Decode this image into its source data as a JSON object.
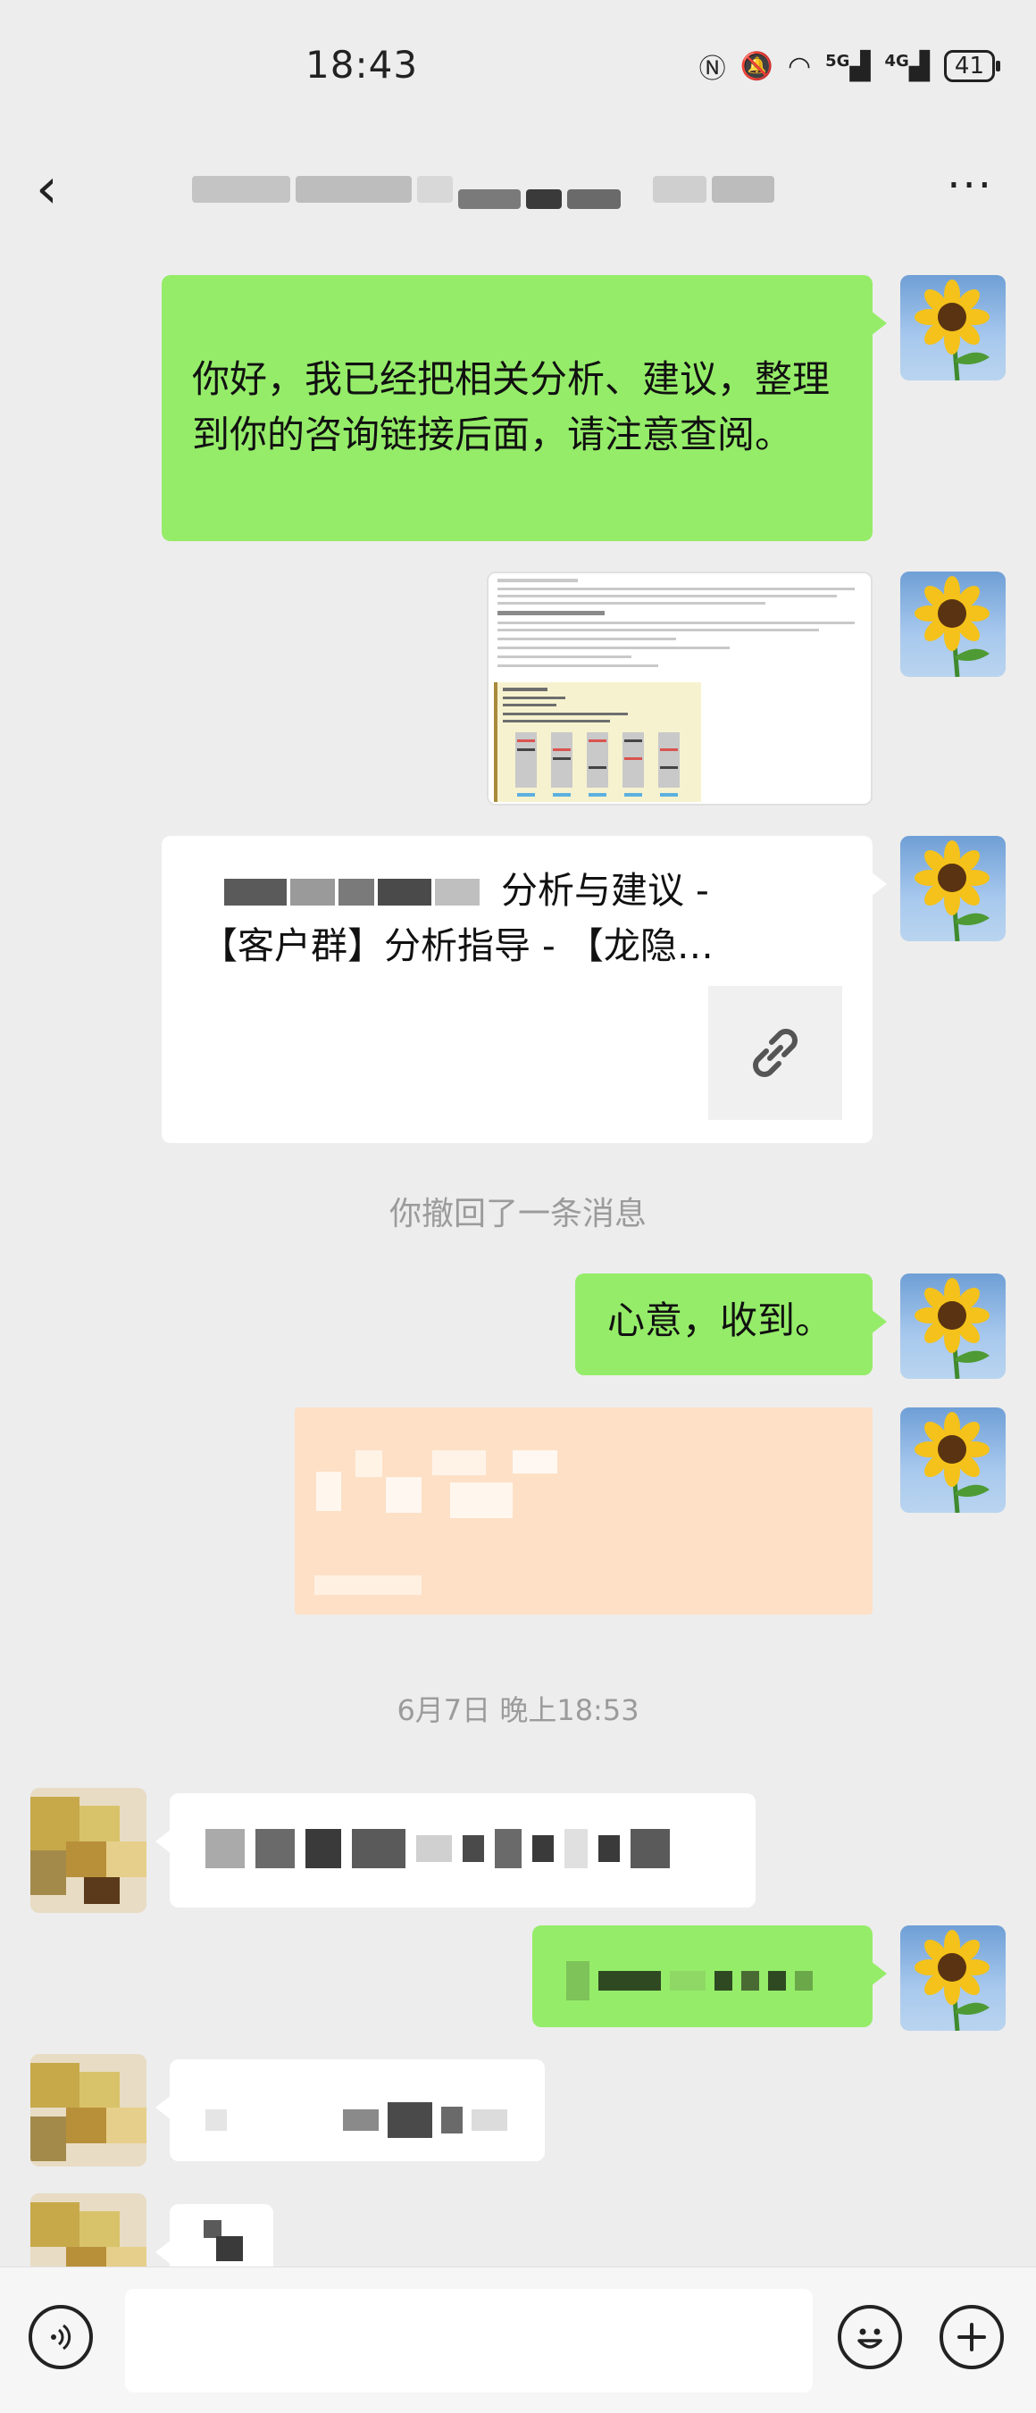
{
  "status_bar": {
    "time": "18:43",
    "nfc_icon": "nfc-icon",
    "mute_icon": "bell-off-icon",
    "wifi_icon": "wifi-icon",
    "network_1": "5G",
    "network_2": "4G",
    "battery": "41"
  },
  "nav": {
    "back_icon": "‹",
    "more_icon": "···"
  },
  "messages": {
    "m1_text": "你好，我已经把相关分析、建议，整理到你的咨询链接后面，请注意查阅。",
    "link_title_line1": "分析与建议 -",
    "link_title_line2": "【客户群】分析指导 - 【龙隐…",
    "link_icon": "link-icon",
    "recalled": "你撤回了一条消息",
    "m4_text": "心意，收到。",
    "timestamp": "6月7日 晚上18:53"
  },
  "colors": {
    "bubble_green": "#95ec69",
    "background": "#ededed",
    "transfer_orange": "#fde0c6"
  }
}
